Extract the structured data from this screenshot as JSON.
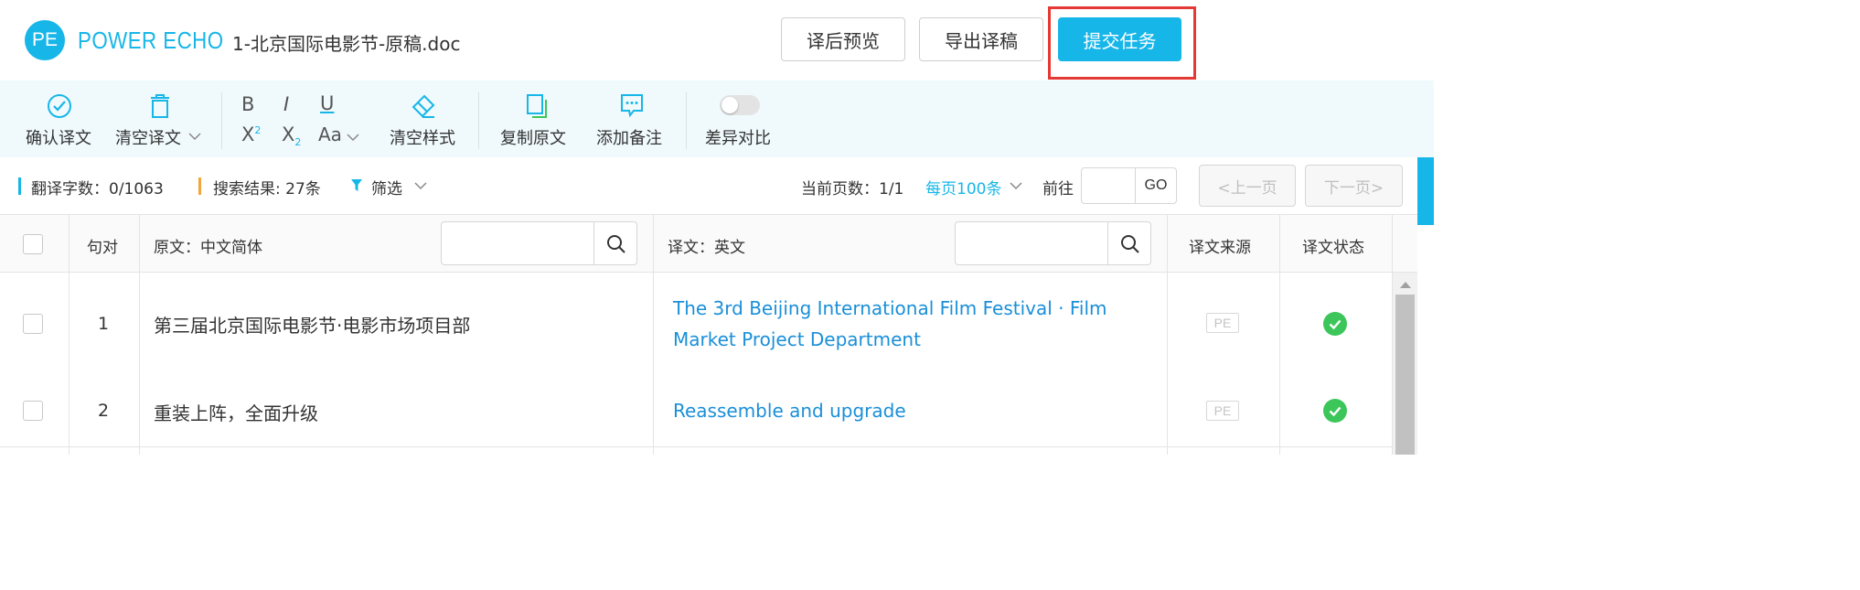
{
  "header": {
    "logo_mark": "PE",
    "logo_text": "POWER ECHO",
    "doc_title": "1-北京国际电影节-原稿.doc",
    "buttons": {
      "preview": "译后预览",
      "export": "导出译稿",
      "submit": "提交任务"
    }
  },
  "toolbar": {
    "confirm": "确认译文",
    "clear_translation": "清空译文",
    "bold": "B",
    "italic": "I",
    "underline": "U",
    "superscript": "X",
    "superscript_mark": "2",
    "subscript": "X",
    "subscript_mark": "2",
    "font_size": "Aa",
    "clear_style": "清空样式",
    "copy_source": "复制原文",
    "add_note": "添加备注",
    "diff_compare": "差异对比"
  },
  "infobar": {
    "word_count": "翻译字数：0/1063",
    "search_results": "搜索结果: 27条",
    "filter": "筛选",
    "current_page": "当前页数：1/1",
    "per_page": "每页100条",
    "goto": "前往",
    "go": "GO",
    "prev": "<上一页",
    "next": "下一页>"
  },
  "table": {
    "columns": {
      "pair": "句对",
      "source": "原文：中文简体",
      "target": "译文：英文",
      "origin": "译文来源",
      "status": "译文状态"
    },
    "rows": [
      {
        "index": "1",
        "source": "第三届北京国际电影节·电影市场项目部",
        "target": "The 3rd Beijing International Film Festival · Film Market Project Department",
        "origin": "PE",
        "status": "confirmed"
      },
      {
        "index": "2",
        "source": "重装上阵，全面升级",
        "target": "Reassemble and upgrade",
        "origin": "PE",
        "status": "confirmed"
      }
    ]
  },
  "colors": {
    "accent": "#17b6e8",
    "link": "#1a8fd8",
    "ok": "#3cc65a",
    "highlight": "#e53935"
  }
}
